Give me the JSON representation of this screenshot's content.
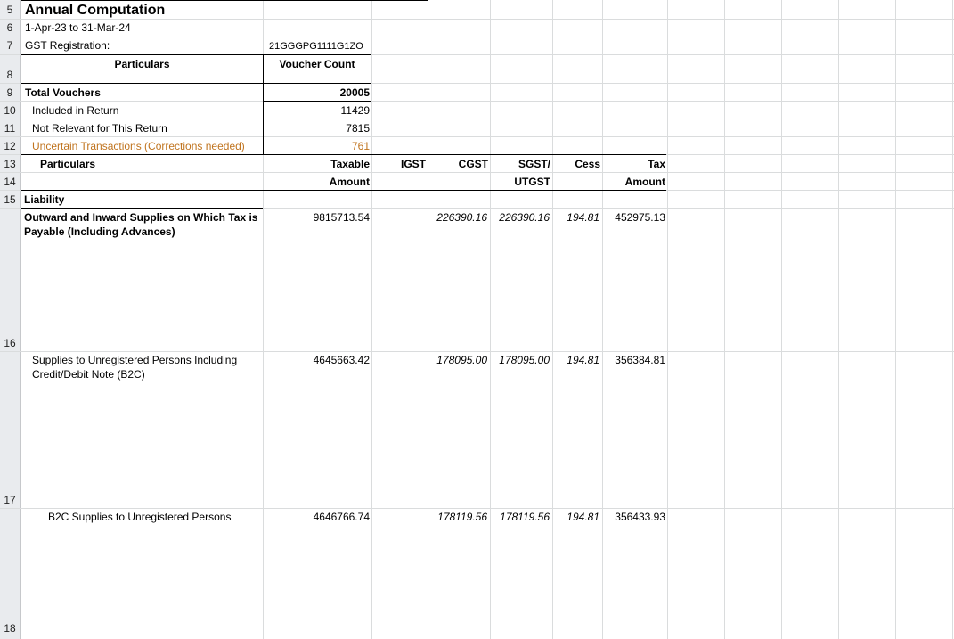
{
  "rows": [
    "5",
    "6",
    "7",
    "8",
    "9",
    "10",
    "11",
    "12",
    "13",
    "14",
    "15",
    "16",
    "17",
    "18"
  ],
  "title": "Annual Computation",
  "period": "1-Apr-23 to 31-Mar-24",
  "gst_label": "GST Registration:",
  "gst_value": "21GGGPG1111G1ZO",
  "summary_header": {
    "particulars": "Particulars",
    "voucher_count": "Voucher Count"
  },
  "summary": [
    {
      "label": "Total Vouchers",
      "value": "20005"
    },
    {
      "label": "Included in Return",
      "value": "11429"
    },
    {
      "label": "Not Relevant for This Return",
      "value": "7815"
    },
    {
      "label": "Uncertain Transactions (Corrections needed)",
      "value": "761"
    }
  ],
  "table_header": {
    "particulars": "Particulars",
    "taxable_1": "Taxable",
    "taxable_2": "Amount",
    "igst": "IGST",
    "cgst": "CGST",
    "sgst_1": "SGST/",
    "sgst_2": "UTGST",
    "cess": "Cess",
    "tax_1": "Tax",
    "tax_2": "Amount"
  },
  "liability_label": "Liability",
  "liability_rows": [
    {
      "label": "Outward and Inward Supplies on Which Tax is Payable (Including Advances)",
      "taxable": "9815713.54",
      "igst": "",
      "cgst": "226390.16",
      "sgst": "226390.16",
      "cess": "194.81",
      "tax": "452975.13"
    },
    {
      "label": "Supplies to Unregistered Persons Including Credit/Debit Note (B2C)",
      "taxable": "4645663.42",
      "igst": "",
      "cgst": "178095.00",
      "sgst": "178095.00",
      "cess": "194.81",
      "tax": "356384.81"
    },
    {
      "label": "B2C Supplies to Unregistered Persons",
      "taxable": "4646766.74",
      "igst": "",
      "cgst": "178119.56",
      "sgst": "178119.56",
      "cess": "194.81",
      "tax": "356433.93"
    }
  ]
}
